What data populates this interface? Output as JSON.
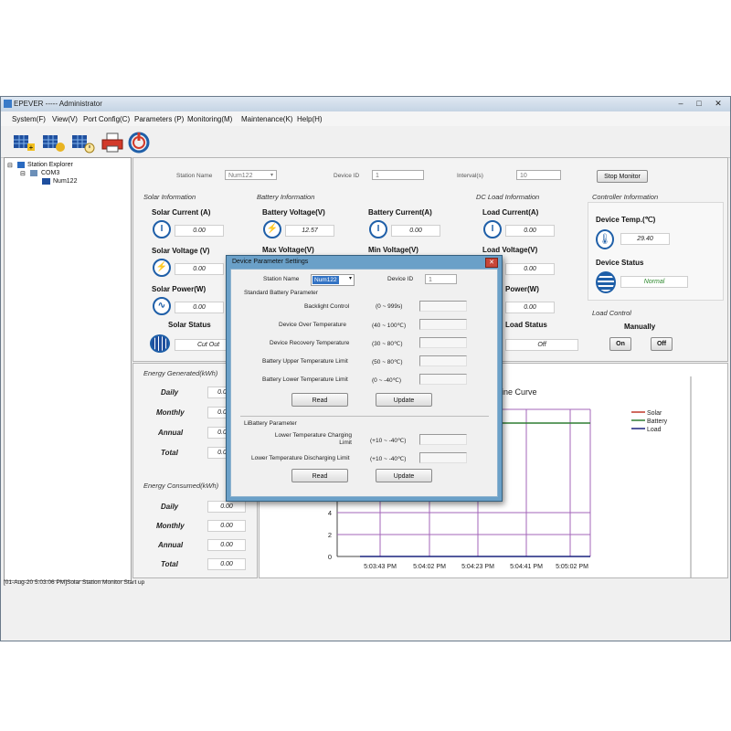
{
  "window": {
    "title": "EPEVER ----- Administrator",
    "minimize": "–",
    "maximize": "□",
    "close": "✕"
  },
  "menu": [
    "System(F)",
    "View(V)",
    "Port Config(C)",
    "Parameters (P)",
    "Monitoring(M)",
    "Maintenance(K)",
    "Help(H)"
  ],
  "toolbar": [
    {
      "icon": "add-station-icon"
    },
    {
      "icon": "station-config-icon"
    },
    {
      "icon": "station-time-icon"
    },
    {
      "icon": "printer-icon"
    },
    {
      "icon": "power-icon"
    }
  ],
  "explorer": {
    "root": "Station Explorer",
    "port": "COM3",
    "device": "Num122"
  },
  "topbar": {
    "station_label": "Station Name",
    "station_value": "Num122",
    "device_id_label": "Device ID",
    "device_id_value": "1",
    "interval_label": "Interval(s)",
    "interval_value": "10",
    "stop_button": "Stop Monitor"
  },
  "solar": {
    "title": "Solar Information",
    "current_label": "Solar Current (A)",
    "current_value": "0.00",
    "voltage_label": "Solar Voltage (V)",
    "voltage_value": "0.00",
    "power_label": "Solar Power(W)",
    "power_value": "0.00",
    "status_label": "Solar Status",
    "status_value": "Cut Out"
  },
  "battery": {
    "title": "Battery Information",
    "voltage_label": "Battery Voltage(V)",
    "voltage_value": "12.57",
    "current_label": "Battery Current(A)",
    "current_value": "0.00",
    "max_label": "Max Voltage(V)",
    "min_label": "Min Voltage(V)"
  },
  "load": {
    "title": "DC Load Information",
    "current_label": "Load Current(A)",
    "current_value": "0.00",
    "voltage_label": "Load Voltage(V)",
    "voltage_value": "0.00",
    "power_label": "Power(W)",
    "power_value": "0.00",
    "status_label": "Load Status",
    "status_value": "Off"
  },
  "controller": {
    "title": "Controller Information",
    "temp_label": "Device Temp.(℃)",
    "temp_value": "29.40",
    "status_label": "Device Status",
    "status_value": "Normal",
    "load_control_title": "Load Control",
    "mode": "Manually",
    "on_button": "On",
    "off_button": "Off"
  },
  "energy_generated": {
    "title": "Energy Generated(kWh)",
    "rows": [
      {
        "label": "Daily",
        "value": "0.0"
      },
      {
        "label": "Monthly",
        "value": "0.0"
      },
      {
        "label": "Annual",
        "value": "0.0"
      },
      {
        "label": "Total",
        "value": "0.0"
      }
    ]
  },
  "energy_consumed": {
    "title": "Energy Consumed(kWh)",
    "rows": [
      {
        "label": "Daily",
        "value": "0.00"
      },
      {
        "label": "Monthly",
        "value": "0.00"
      },
      {
        "label": "Annual",
        "value": "0.00"
      },
      {
        "label": "Total",
        "value": "0.00"
      }
    ]
  },
  "chart": {
    "title_fragment": "ine Curve",
    "legend": [
      {
        "name": "Solar",
        "color": "#c0392b"
      },
      {
        "name": "Battery",
        "color": "#2e7d32"
      },
      {
        "name": "Load",
        "color": "#1a237e"
      }
    ],
    "y_ticks": [
      "0",
      "2",
      "4"
    ],
    "x_ticks": [
      "5:03:43 PM",
      "5:04:02 PM",
      "5:04:23 PM",
      "5:04:41 PM",
      "5:05:02 PM"
    ]
  },
  "status_message": "[01-Aug-20 5:03:06 PM]Solar Station Monitor Start up",
  "dialog": {
    "title": "Device Parameter Settings",
    "close": "✕",
    "station_label": "Station Name",
    "station_value": "Num122",
    "device_id_label": "Device ID",
    "device_id_value": "1",
    "std_group": "Standard Battery Parameter",
    "std_rows": [
      {
        "label": "Backlight Control",
        "range": "(0 ~ 999s)"
      },
      {
        "label": "Device Over Temperature",
        "range": "(40 ~ 100℃)"
      },
      {
        "label": "Device Recovery Temperature",
        "range": "(30 ~ 80℃)"
      },
      {
        "label": "Battery Upper Temperature Limit",
        "range": "(50 ~ 80℃)"
      },
      {
        "label": "Battery Lower Temperature Limit",
        "range": "(0 ~ -40℃)"
      }
    ],
    "read_button": "Read",
    "update_button": "Update",
    "li_group": "LiBattery Parameter",
    "li_rows": [
      {
        "label": "Lower Temperature Charging Limit",
        "range": "(+10 ~ -40℃)"
      },
      {
        "label": "Lower Temperature Discharging Limit",
        "range": "(+10 ~ -40℃)"
      }
    ]
  }
}
